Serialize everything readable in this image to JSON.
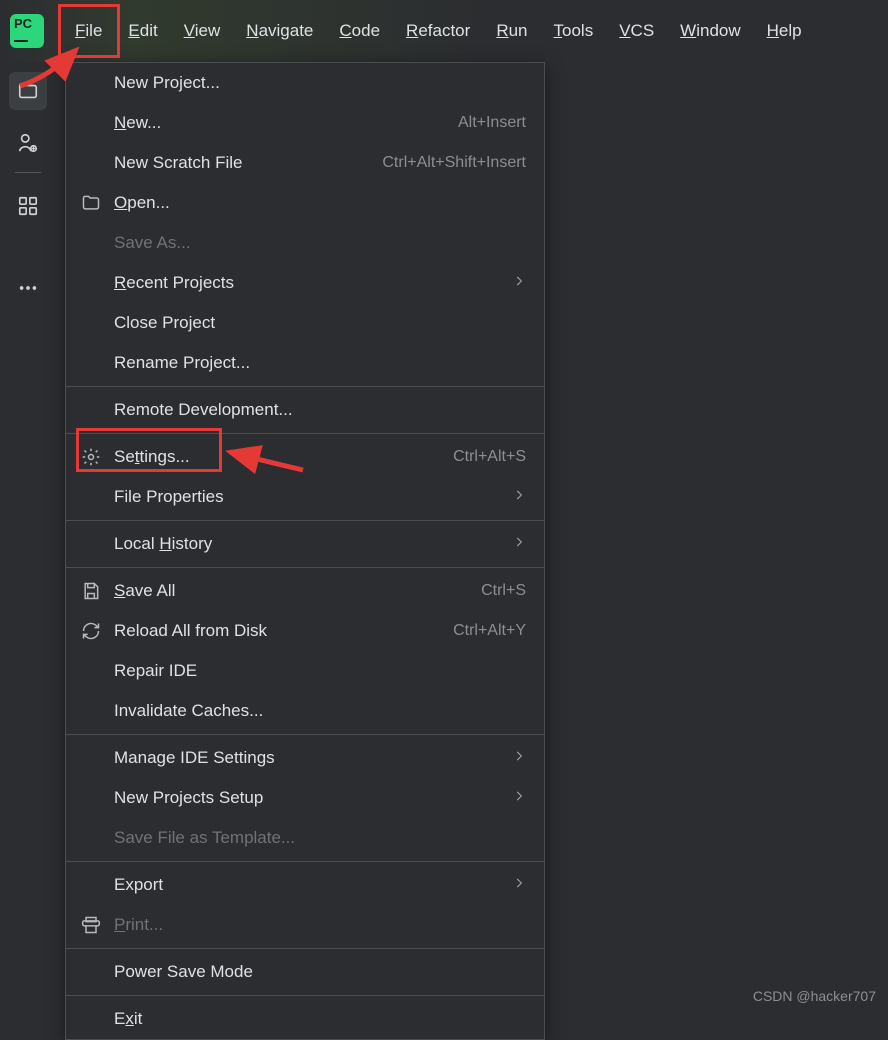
{
  "menubar": {
    "items": [
      "File",
      "Edit",
      "View",
      "Navigate",
      "Code",
      "Refactor",
      "Run",
      "Tools",
      "VCS",
      "Window",
      "Help"
    ]
  },
  "file_menu": {
    "groups": [
      [
        {
          "label": "New Project..."
        },
        {
          "label": "New...",
          "mnemonic": "N",
          "shortcut": "Alt+Insert"
        },
        {
          "label": "New Scratch File",
          "shortcut": "Ctrl+Alt+Shift+Insert"
        },
        {
          "label": "Open...",
          "mnemonic": "O",
          "icon": "folder"
        },
        {
          "label": "Save As...",
          "disabled": true
        },
        {
          "label": "Recent Projects",
          "mnemonic": "R",
          "submenu": true
        },
        {
          "label": "Close Project"
        },
        {
          "label": "Rename Project..."
        }
      ],
      [
        {
          "label": "Remote Development..."
        }
      ],
      [
        {
          "label": "Settings...",
          "mnemonic": "t",
          "icon": "gear",
          "shortcut": "Ctrl+Alt+S",
          "highlight": true
        },
        {
          "label": "File Properties",
          "submenu": true
        }
      ],
      [
        {
          "label": "Local History",
          "mnemonic": "H",
          "submenu": true
        }
      ],
      [
        {
          "label": "Save All",
          "mnemonic": "S",
          "icon": "save",
          "shortcut": "Ctrl+S"
        },
        {
          "label": "Reload All from Disk",
          "icon": "reload",
          "shortcut": "Ctrl+Alt+Y"
        },
        {
          "label": "Repair IDE"
        },
        {
          "label": "Invalidate Caches..."
        }
      ],
      [
        {
          "label": "Manage IDE Settings",
          "submenu": true
        },
        {
          "label": "New Projects Setup",
          "submenu": true
        },
        {
          "label": "Save File as Template...",
          "disabled": true
        }
      ],
      [
        {
          "label": "Export",
          "submenu": true
        },
        {
          "label": "Print...",
          "mnemonic": "P",
          "icon": "printer",
          "disabled": true
        }
      ],
      [
        {
          "label": "Power Save Mode"
        }
      ],
      [
        {
          "label": "Exit",
          "mnemonic": "x"
        }
      ]
    ]
  },
  "watermark": "CSDN @hacker707"
}
